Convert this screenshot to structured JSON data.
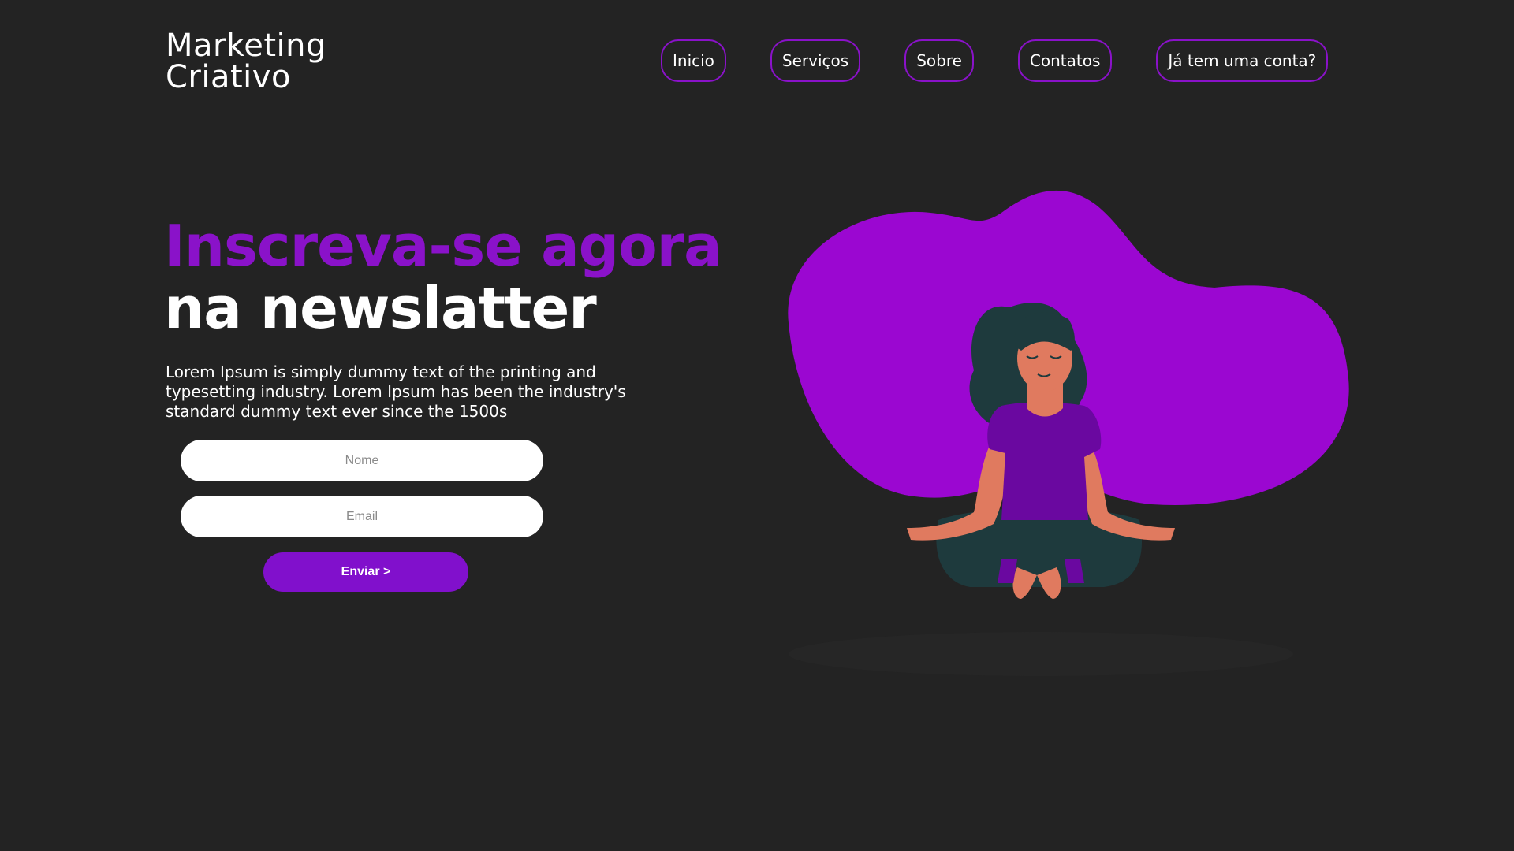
{
  "header": {
    "logo_line1": "Marketing",
    "logo_line2": "Criativo",
    "nav": [
      {
        "label": "Inicio"
      },
      {
        "label": "Serviços"
      },
      {
        "label": "Sobre"
      },
      {
        "label": "Contatos"
      },
      {
        "label": "Já tem uma conta?"
      }
    ]
  },
  "hero": {
    "headline_line1": "Inscreva-se agora",
    "headline_line2": "na newslatter",
    "description": "Lorem Ipsum is simply dummy text of the printing and typesetting industry. Lorem Ipsum has been the industry's standard dummy text ever since the 1500s"
  },
  "form": {
    "name_placeholder": "Nome",
    "email_placeholder": "Email",
    "submit_label": "Enviar >"
  },
  "illustration": {
    "icon": "meditating-woman-illustration"
  },
  "colors": {
    "background": "#232323",
    "accent": "#8a12c9",
    "blob": "#9b07d1",
    "button": "#8110cc"
  }
}
